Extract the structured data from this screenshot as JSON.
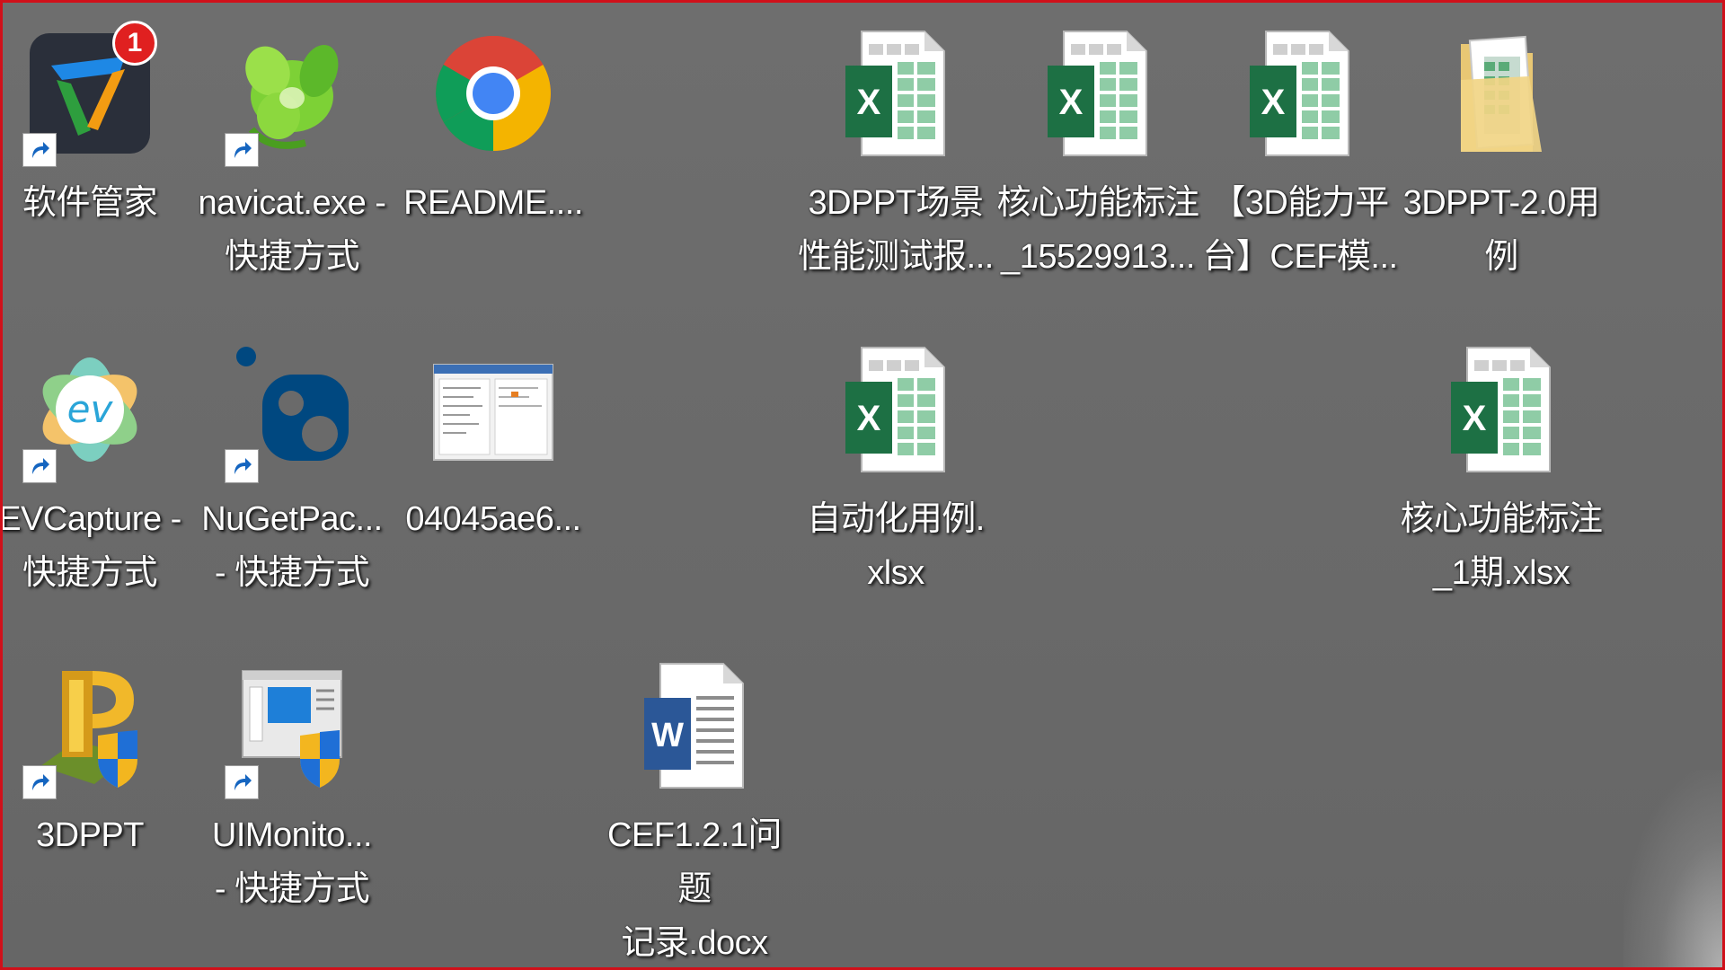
{
  "desktop": {
    "icons": [
      {
        "label": "软件管家",
        "badge": "1"
      },
      {
        "label": "navicat.exe -\n快捷方式"
      },
      {
        "label": "README...."
      },
      {
        "label": "3DPPT场景\n性能测试报..."
      },
      {
        "label": "核心功能标注\n_15529913..."
      },
      {
        "label": "【3D能力平\n台】CEF模..."
      },
      {
        "label": "3DPPT-2.0用\n例"
      },
      {
        "label": "EVCapture -\n快捷方式"
      },
      {
        "label": "NuGetPac...\n- 快捷方式"
      },
      {
        "label": "04045ae6..."
      },
      {
        "label": "自动化用例.\nxlsx"
      },
      {
        "label": "核心功能标注\n_1期.xlsx"
      },
      {
        "label": "3DPPT"
      },
      {
        "label": "UIMonito...\n- 快捷方式"
      },
      {
        "label": "CEF1.2.1问题\n记录.docx"
      }
    ]
  },
  "colors": {
    "desktop_bg": "#6a6a6a",
    "frame_border": "#d0101a",
    "excel_green": "#1d7044",
    "word_blue": "#2b5797"
  }
}
